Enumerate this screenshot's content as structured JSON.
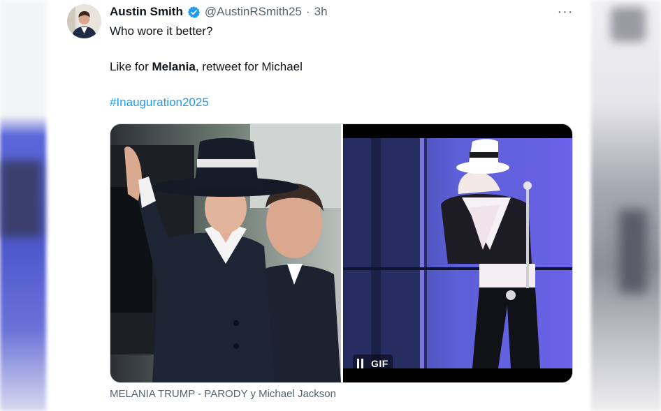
{
  "tweet": {
    "author_name": "Austin Smith",
    "handle": "@AustinRSmith25",
    "separator": "·",
    "time": "3h",
    "more_menu_label": "···",
    "text_line_1": "Who wore it better?",
    "text_line_2_prefix": "Like for ",
    "text_line_2_bold": "Melania",
    "text_line_2_suffix": ", retweet for Michael",
    "hashtag": "#Inauguration2025",
    "verified_icon": "verified-badge-icon",
    "accent_color": "#1d9bf0"
  },
  "media": {
    "gif_label": "GIF",
    "pause_icon": "pause-icon",
    "caption": "MELANIA TRUMP - PARODY y Michael Jackson"
  }
}
